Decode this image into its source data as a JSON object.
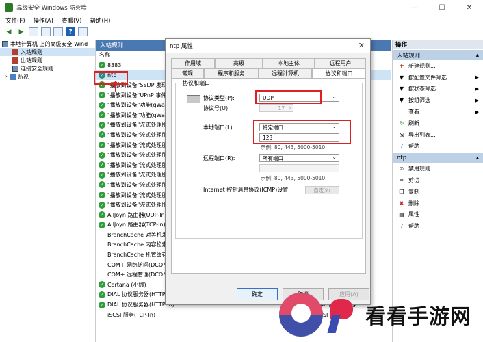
{
  "window": {
    "title": "高级安全 Windows 防火墙",
    "controls": [
      "—",
      "☐",
      "✕"
    ]
  },
  "menu": [
    "文件(F)",
    "操作(A)",
    "查看(V)",
    "帮助(H)"
  ],
  "tree": {
    "root": "本地计算机 上的高级安全 Wind",
    "items": [
      "入站规则",
      "出站规则",
      "连接安全规则",
      "监视"
    ]
  },
  "middle": {
    "header": "入站规则",
    "column_name": "名称",
    "rules": [
      {
        "name": "8383",
        "check": true,
        "group": ""
      },
      {
        "name": "ntp",
        "check": true,
        "group": ""
      },
      {
        "name": "\"播放到设备\"SSDP 发现",
        "check": true,
        "group": ""
      },
      {
        "name": "\"播放到设备\"UPnP 事件",
        "check": true,
        "group": ""
      },
      {
        "name": "\"播放到设备\"功能(qWave",
        "check": true,
        "group": ""
      },
      {
        "name": "\"播放到设备\"功能(qWave",
        "check": true,
        "group": ""
      },
      {
        "name": "\"播放到设备\"流式处理服",
        "check": true,
        "group": ""
      },
      {
        "name": "\"播放到设备\"流式处理服",
        "check": true,
        "group": ""
      },
      {
        "name": "\"播放到设备\"流式处理服",
        "check": true,
        "group": ""
      },
      {
        "name": "\"播放到设备\"流式处理服",
        "check": true,
        "group": ""
      },
      {
        "name": "\"播放到设备\"流式处理服",
        "check": true,
        "group": ""
      },
      {
        "name": "\"播放到设备\"流式处理服",
        "check": true,
        "group": ""
      },
      {
        "name": "\"播放到设备\"流式处理服",
        "check": true,
        "group": ""
      },
      {
        "name": "\"播放到设备\"流式处理服",
        "check": true,
        "group": ""
      },
      {
        "name": "\"播放到设备\"流式处理服",
        "check": true,
        "group": ""
      },
      {
        "name": "AllJoyn 路由器(UDP-In)",
        "check": true,
        "group": ""
      },
      {
        "name": "AllJoyn 路由器(TCP-In)",
        "check": true,
        "group": ""
      },
      {
        "name": "BranchCache 对等机发现",
        "check": false,
        "group": ""
      },
      {
        "name": "BranchCache 内容检索",
        "check": false,
        "group": ""
      },
      {
        "name": "BranchCache 托管缓存",
        "check": false,
        "group": ""
      },
      {
        "name": "COM+ 网络访问(DCOM-In)",
        "check": false,
        "group": ""
      },
      {
        "name": "COM+ 远程管理(DCOM-In)",
        "check": false,
        "group": ""
      },
      {
        "name": "Cortana (小娜)",
        "check": true,
        "group": ""
      },
      {
        "name": "DIAL 协议服务器(HTTP-In)",
        "check": true,
        "group": "DIAL 协议服务器"
      },
      {
        "name": "DIAL 协议服务器(HTTP-In)",
        "check": true,
        "group": "DIAL 协议服务器"
      },
      {
        "name": "iSCSI 服务(TCP-In)",
        "check": false,
        "group": "iSCSI 服务"
      }
    ]
  },
  "actions": {
    "title": "操作",
    "section1": "入站规则",
    "items1": [
      {
        "label": "新建规则...",
        "icon": "new-rule-icon",
        "sub": false
      },
      {
        "label": "按配置文件筛选",
        "icon": "filter-icon",
        "sub": true
      },
      {
        "label": "按状态筛选",
        "icon": "filter-icon",
        "sub": true
      },
      {
        "label": "按组筛选",
        "icon": "filter-icon",
        "sub": true
      },
      {
        "label": "查看",
        "icon": "",
        "sub": true
      },
      {
        "label": "刷新",
        "icon": "refresh-icon",
        "sub": false
      },
      {
        "label": "导出列表...",
        "icon": "export-icon",
        "sub": false
      },
      {
        "label": "帮助",
        "icon": "help-icon",
        "sub": false
      }
    ],
    "section2": "ntp",
    "items2": [
      {
        "label": "禁用规则",
        "icon": "disable-icon"
      },
      {
        "label": "剪切",
        "icon": "cut-icon"
      },
      {
        "label": "复制",
        "icon": "copy-icon"
      },
      {
        "label": "删除",
        "icon": "delete-icon"
      },
      {
        "label": "属性",
        "icon": "properties-icon"
      },
      {
        "label": "帮助",
        "icon": "help-icon"
      }
    ]
  },
  "dialog": {
    "title": "ntp 属性",
    "tabs_row1": [
      "作用域",
      "高级",
      "本地主体",
      "远程用户"
    ],
    "tabs_row2": [
      "常规",
      "程序和服务",
      "远程计算机",
      "协议和端口"
    ],
    "group_title": "协议和端口",
    "protocol_type_label": "协议类型(P):",
    "protocol_type_value": "UDP",
    "protocol_number_label": "协议号(U):",
    "protocol_number_value": "17",
    "local_port_label": "本地端口(L):",
    "local_port_select": "特定端口",
    "local_port_value": "123",
    "local_port_hint": "示例: 80, 443, 5000-5010",
    "remote_port_label": "远程端口(R):",
    "remote_port_select": "所有端口",
    "remote_port_hint": "示例: 80, 443, 5000-5010",
    "icmp_label": "Internet 控制消息协议(ICMP)设置:",
    "icmp_button": "自定义(",
    "ok": "确定",
    "cancel": "取消",
    "apply": "应用(A)"
  },
  "watermark": {
    "text": "看看手游网"
  },
  "colors": {
    "header_blue": "#4a78b0",
    "check_green": "#2e9e3a",
    "highlight_red": "#e02020"
  }
}
